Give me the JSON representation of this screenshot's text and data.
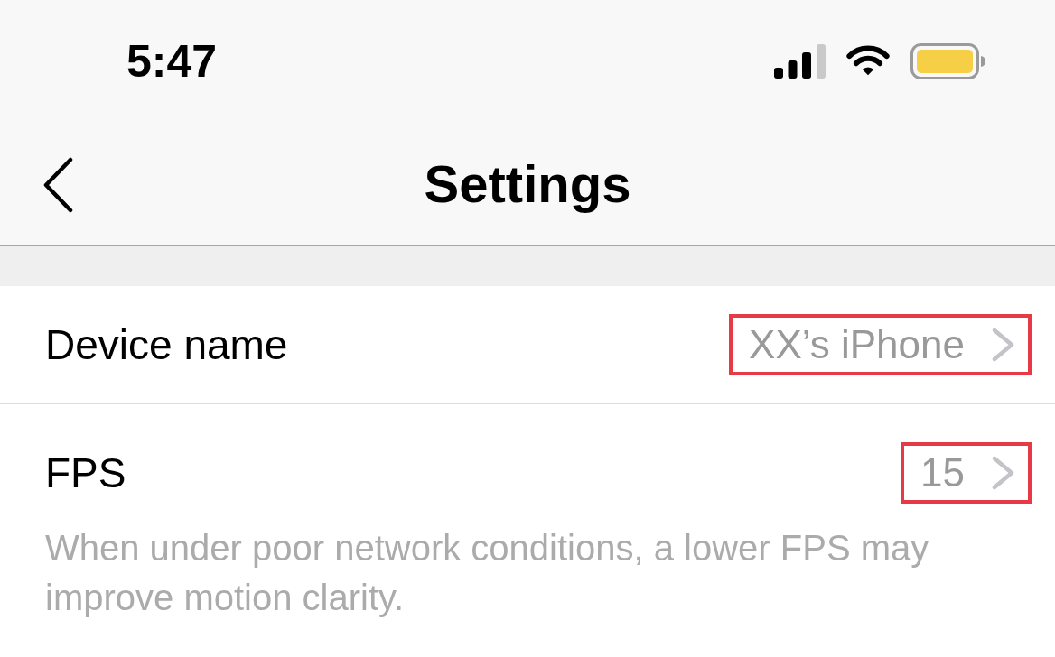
{
  "status_bar": {
    "time": "5:47"
  },
  "nav_bar": {
    "title": "Settings"
  },
  "rows": [
    {
      "label": "Device name",
      "value": "XX’s iPhone",
      "highlighted": true
    },
    {
      "label": "FPS",
      "value": "15",
      "highlighted": true,
      "footnote": "When under poor network conditions, a lower FPS may improve motion clarity."
    }
  ]
}
